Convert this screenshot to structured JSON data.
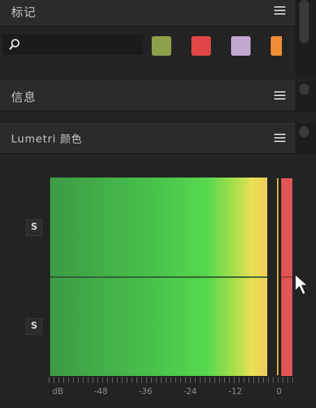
{
  "markers_panel": {
    "title": "标记",
    "search_placeholder": "",
    "color_swatches": [
      "#8fa04b",
      "#e24646",
      "#c2a6d0",
      "#f08d35"
    ]
  },
  "info_panel": {
    "title": "信息"
  },
  "lumetri_panel": {
    "title": "Lumetri 颜色"
  },
  "audio_meter": {
    "solo_buttons": [
      "S",
      "S"
    ],
    "scale_labels": [
      "dB",
      "-48",
      "-36",
      "-24",
      "-12",
      "0"
    ]
  }
}
